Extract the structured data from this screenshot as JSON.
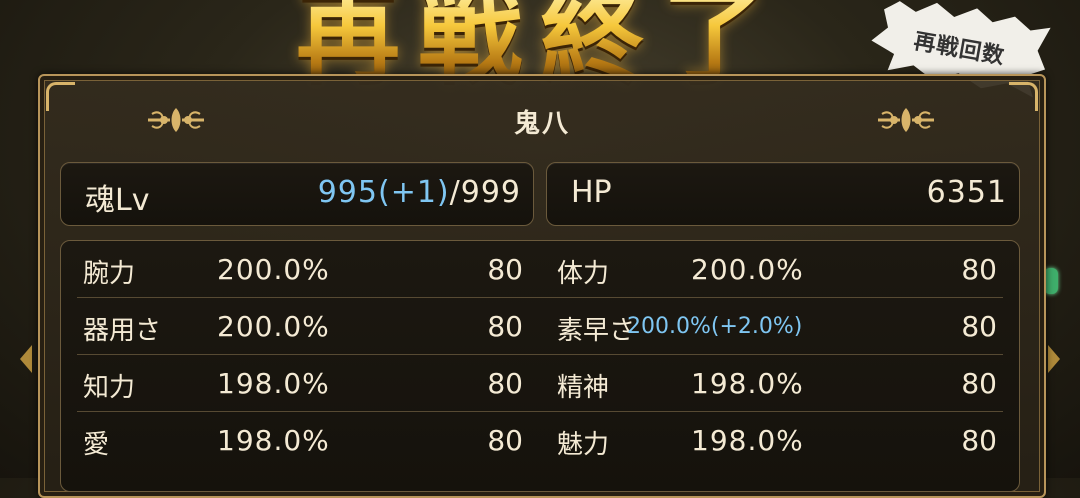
{
  "banner": {
    "title": "再戦終了"
  },
  "badge": {
    "label": "再戦回数"
  },
  "panel": {
    "title": "鬼八",
    "soul": {
      "label": "魂Lv",
      "value": "995",
      "bonus": "(+1)",
      "max": "/999"
    },
    "hp": {
      "label": "HP",
      "value": "6351"
    },
    "stats": [
      {
        "left_label": "腕力",
        "left_pct": "200.0%",
        "left_val": "80",
        "right_label": "体力",
        "right_pct": "200.0%",
        "right_val": "80"
      },
      {
        "left_label": "器用さ",
        "left_pct": "200.0%",
        "left_val": "80",
        "right_label": "素早さ",
        "right_pct": "200.0%(+2.0%)",
        "right_val": "80"
      },
      {
        "left_label": "知力",
        "left_pct": "198.0%",
        "left_val": "80",
        "right_label": "精神",
        "right_pct": "198.0%",
        "right_val": "80"
      },
      {
        "left_label": "愛",
        "left_pct": "198.0%",
        "left_val": "80",
        "right_label": "魅力",
        "right_pct": "198.0%",
        "right_val": "80"
      }
    ]
  },
  "colors": {
    "gold": "#d8b46a",
    "text": "#f4ead4",
    "highlight": "#7fc6f2"
  },
  "icons": {
    "left_arrow": "chevron-left-icon",
    "right_arrow": "chevron-right-icon",
    "ornament": "fleur-ornament-icon"
  }
}
